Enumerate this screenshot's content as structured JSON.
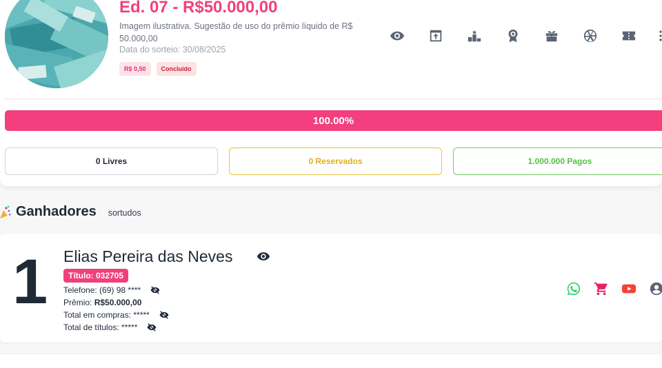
{
  "raffle": {
    "title": "Ed. 07 - R$50.000,00",
    "description": "Imagem ilustrativa. Sugestão de uso do prêmio líquido de R$ 50.000,00",
    "draw_date": "Data do sorteio: 30/08/2025",
    "price_badge": "R$ 0,50",
    "status_badge": "Concluído"
  },
  "actions": [
    {
      "icon": "eye-icon"
    },
    {
      "icon": "share-icon"
    },
    {
      "icon": "podium-icon"
    },
    {
      "icon": "award-icon"
    },
    {
      "icon": "gift-icon"
    },
    {
      "icon": "shutter-icon"
    },
    {
      "icon": "ticket-icon"
    },
    {
      "icon": "more-vertical-icon"
    }
  ],
  "progress": {
    "label": "100.00%",
    "value": 1.0
  },
  "counters": {
    "free": "0 Livres",
    "reserved": "0 Reservados",
    "paid": "1.000.000 Pagos"
  },
  "winners": {
    "title": "Ganhadores",
    "subtitle": "sortudos",
    "items": [
      {
        "rank": "1",
        "name": "Elias Pereira das Neves",
        "ticket": "Título: 032705",
        "phone": "Telefone: (69) 98 ****",
        "prize_label": "Prêmio:",
        "prize_value": "R$50.000,00",
        "total_purchases": "Total em compras: *****",
        "total_titles": "Total de títulos: *****"
      }
    ]
  },
  "colors": {
    "brand_pink": "#f0407a",
    "progress": "#f33f7e",
    "reserved": "#e0b018",
    "paid": "#55c043",
    "whatsapp": "#25d366",
    "cart": "#e91e63",
    "youtube": "#f44336"
  }
}
